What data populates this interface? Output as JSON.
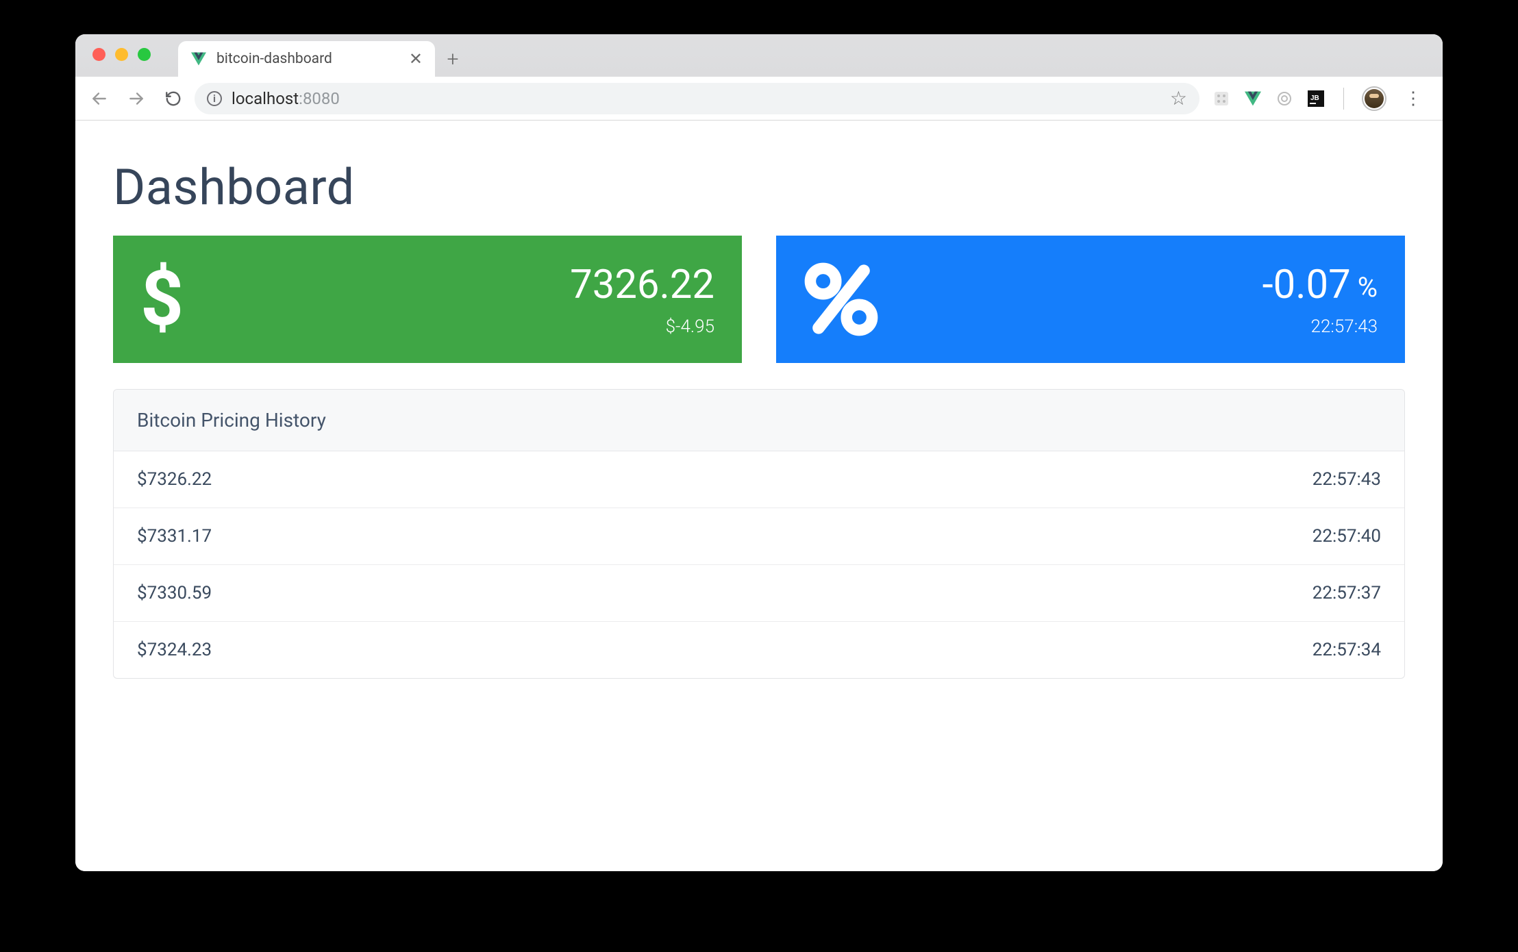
{
  "browser": {
    "tab_title": "bitcoin-dashboard",
    "url_host": "localhost",
    "url_port": ":8080"
  },
  "page": {
    "title": "Dashboard",
    "price_card": {
      "value": "7326.22",
      "delta": "$-4.95"
    },
    "percent_card": {
      "value": "-0.07",
      "unit": "%",
      "time": "22:57:43"
    },
    "history": {
      "title": "Bitcoin Pricing History",
      "rows": [
        {
          "price": "$7326.22",
          "time": "22:57:43"
        },
        {
          "price": "$7331.17",
          "time": "22:57:40"
        },
        {
          "price": "$7330.59",
          "time": "22:57:37"
        },
        {
          "price": "$7324.23",
          "time": "22:57:34"
        }
      ]
    }
  }
}
